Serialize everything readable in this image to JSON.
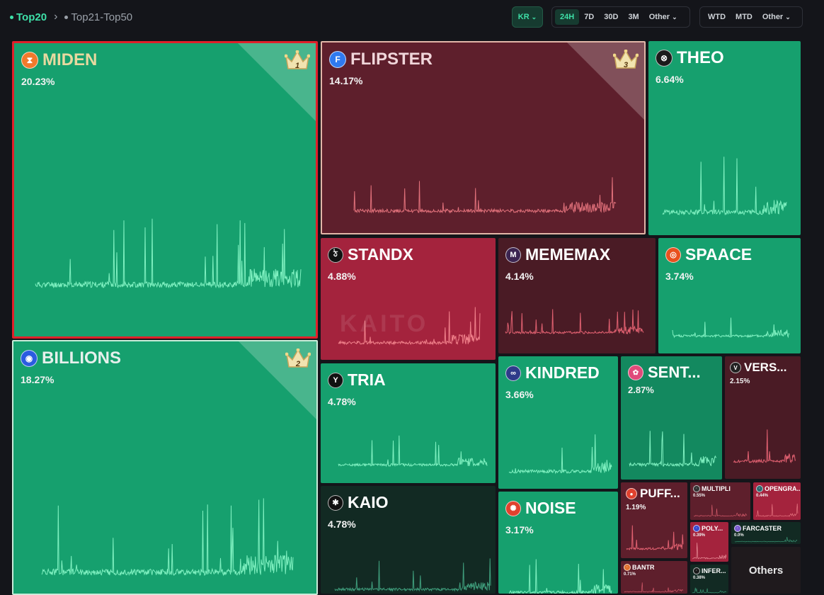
{
  "breadcrumb": {
    "active": "Top20",
    "inactive": "Top21-Top50"
  },
  "lang": "KR",
  "time_filters": [
    "24H",
    "7D",
    "30D",
    "3M",
    "Other"
  ],
  "time_selected": "24H",
  "period_filters": [
    "WTD",
    "MTD",
    "Other"
  ],
  "colors": {
    "accent": "#3ee0a8",
    "up": "#16a06e",
    "down": "#a4233d"
  },
  "watermark": "KAITO",
  "others_label": "Others",
  "tiles": [
    {
      "id": "miden",
      "name": "MIDEN",
      "pct": "20.23%",
      "rank": "1",
      "icon": "hourglass-icon",
      "glyph": "⧗",
      "iconColor": "#f07a2c"
    },
    {
      "id": "billions",
      "name": "BILLIONS",
      "pct": "18.27%",
      "rank": "2",
      "icon": "robot-icon",
      "glyph": "◉",
      "iconColor": "#2a5ce0"
    },
    {
      "id": "flipster",
      "name": "FLIPSTER",
      "pct": "14.17%",
      "rank": "3",
      "icon": "flipster-f-icon",
      "glyph": "F",
      "iconColor": "#2f7af0"
    },
    {
      "id": "theo",
      "name": "THEO",
      "pct": "6.64%",
      "icon": "theo-icon",
      "glyph": "⊗",
      "iconColor": "#1b1b1b"
    },
    {
      "id": "standx",
      "name": "STANDX",
      "pct": "4.88%",
      "icon": "standx-icon",
      "glyph": "ঠ",
      "iconColor": "#111111"
    },
    {
      "id": "mememax",
      "name": "MEMEMAX",
      "pct": "4.14%",
      "icon": "mememax-icon",
      "glyph": "M",
      "iconColor": "#3b2450"
    },
    {
      "id": "spaace",
      "name": "SPAACE",
      "pct": "3.74%",
      "icon": "spaace-icon",
      "glyph": "◎",
      "iconColor": "#e8501e"
    },
    {
      "id": "tria",
      "name": "TRIA",
      "pct": "4.78%",
      "icon": "tria-icon",
      "glyph": "Y",
      "iconColor": "#111111"
    },
    {
      "id": "kindred",
      "name": "KINDRED",
      "pct": "3.66%",
      "icon": "infinity-icon",
      "glyph": "∞",
      "iconColor": "#2e3b8a"
    },
    {
      "id": "sent",
      "name": "SENT...",
      "pct": "2.87%",
      "icon": "sentient-icon",
      "glyph": "✿",
      "iconColor": "#e04a7a"
    },
    {
      "id": "vers",
      "name": "VERS...",
      "pct": "2.15%",
      "icon": "vers-icon",
      "glyph": "V",
      "iconColor": "#222222"
    },
    {
      "id": "kaio",
      "name": "KAIO",
      "pct": "4.78%",
      "icon": "kaio-icon",
      "glyph": "✱",
      "iconColor": "#111111"
    },
    {
      "id": "noise",
      "name": "NOISE",
      "pct": "3.17%",
      "icon": "noise-icon",
      "glyph": "✺",
      "iconColor": "#e0412e"
    },
    {
      "id": "puff",
      "name": "PUFF...",
      "pct": "1.19%",
      "icon": "puff-icon",
      "glyph": "●",
      "iconColor": "#e0412e"
    },
    {
      "id": "multipli",
      "name": "MULTIPLI",
      "pct": "0.55%",
      "icon": "multipli-icon",
      "glyph": "·",
      "iconColor": "#333333"
    },
    {
      "id": "opengra",
      "name": "OPENGRA...",
      "pct": "0.44%",
      "icon": "opengradient-icon",
      "glyph": "·",
      "iconColor": "#2a6a70"
    },
    {
      "id": "poly",
      "name": "POLY...",
      "pct": "0.39%",
      "icon": "poly-icon",
      "glyph": "·",
      "iconColor": "#3a4ad0"
    },
    {
      "id": "farcaster",
      "name": "FARCASTER",
      "pct": "0.0%",
      "icon": "farcaster-icon",
      "glyph": "·",
      "iconColor": "#7a5ad0"
    },
    {
      "id": "bantr",
      "name": "BANTR",
      "pct": "0.71%",
      "icon": "bantr-icon",
      "glyph": "·",
      "iconColor": "#e0702e"
    },
    {
      "id": "infer",
      "name": "INFER...",
      "pct": "0.38%",
      "icon": "infer-icon",
      "glyph": "·",
      "iconColor": "#1a1a1a"
    }
  ]
}
